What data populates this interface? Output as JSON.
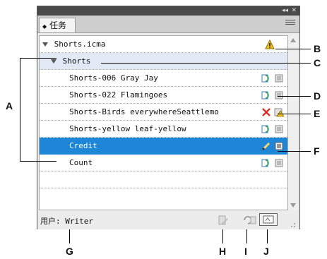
{
  "panel": {
    "title_controls": {
      "collapse": "◂◂",
      "close": "✕"
    },
    "tab_label": "任务",
    "user_label": "用户",
    "user_value": "Writer"
  },
  "rows": [
    {
      "label": "Shorts.icma"
    },
    {
      "label": "Shorts"
    },
    {
      "label": "Shorts-006 Gray Jay"
    },
    {
      "label": "Shorts-022 Flamingoes"
    },
    {
      "label": "Shorts-Birds everywhereSeattlemo"
    },
    {
      "label": "Shorts-yellow leaf-yellow"
    },
    {
      "label": "Credit"
    },
    {
      "label": "Count"
    }
  ],
  "callouts": {
    "A": "A",
    "B": "B",
    "C": "C",
    "D": "D",
    "E": "E",
    "F": "F",
    "G": "G",
    "H": "H",
    "I": "I",
    "J": "J"
  },
  "colors": {
    "selection": "#1e86d6",
    "warning": "#f2c21b",
    "error": "#d9302b"
  }
}
